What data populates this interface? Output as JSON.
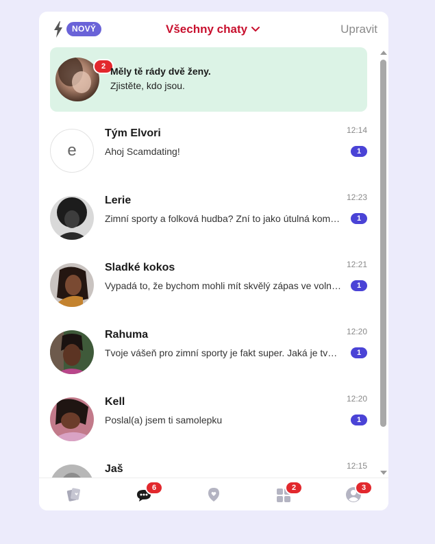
{
  "header": {
    "new_badge": "NOVÝ",
    "title": "Všechny chaty",
    "edit": "Upravit"
  },
  "promo": {
    "title": "Měly tě rády dvě ženy.",
    "subtitle": "Zjistěte, kdo jsou.",
    "count": "2"
  },
  "chats": [
    {
      "name": "Tým Elvori",
      "time": "12:14",
      "preview": "Ahoj Scamdating!",
      "unread": "1",
      "avatar_letter": "e"
    },
    {
      "name": "Lerie",
      "time": "12:23",
      "preview": "Zimní sporty a folková hudba? Zní to jako útulná kombinace",
      "unread": "1"
    },
    {
      "name": "Sladké kokos",
      "time": "12:21",
      "preview": "Vypadá to, že bychom mohli mít skvělý zápas ve volném čase",
      "unread": "1"
    },
    {
      "name": "Rahuma",
      "time": "12:20",
      "preview": "Tvoje vášeň pro zimní sporty je fakt super. Jaká je tvoje oblíbená",
      "unread": "1"
    },
    {
      "name": "Kell",
      "time": "12:20",
      "preview": "Poslal(a) jsem ti samolepku",
      "unread": "1"
    },
    {
      "name": "Jaš",
      "time": "12:15",
      "preview": "",
      "unread": ""
    }
  ],
  "tabbar": {
    "chats_count": "6",
    "apps_count": "2",
    "profile_count": "3"
  },
  "colors": {
    "accent_red": "#c8102e",
    "badge_purple": "#6a63d8",
    "unread_blue": "#4a43d6",
    "promo_green": "#dcf3e6"
  },
  "icons": [
    "bolt-icon",
    "chevron-down-icon",
    "cards-icon",
    "chat-bubbles-icon",
    "location-heart-icon",
    "apps-grid-icon",
    "profile-icon"
  ]
}
